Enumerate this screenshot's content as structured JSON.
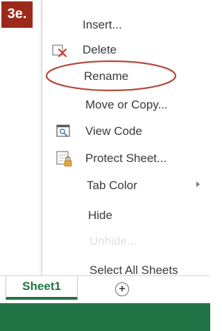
{
  "step_badge": "3e.",
  "menu": {
    "items": [
      {
        "label": "Insert...",
        "icon": null,
        "disabled": false,
        "submenu": false
      },
      {
        "label": "Delete",
        "icon": "delete-sheet-icon",
        "disabled": false,
        "submenu": false
      },
      {
        "label": "Rename",
        "icon": null,
        "disabled": false,
        "submenu": false,
        "highlighted": true
      },
      {
        "label": "Move or Copy...",
        "icon": null,
        "disabled": false,
        "submenu": false
      },
      {
        "label": "View Code",
        "icon": "view-code-icon",
        "disabled": false,
        "submenu": false
      },
      {
        "label": "Protect Sheet...",
        "icon": "protect-sheet-icon",
        "disabled": false,
        "submenu": false
      },
      {
        "label": "Tab Color",
        "icon": null,
        "disabled": false,
        "submenu": true
      },
      {
        "label": "Hide",
        "icon": null,
        "disabled": false,
        "submenu": false
      },
      {
        "label": "Unhide...",
        "icon": null,
        "disabled": true,
        "submenu": false
      },
      {
        "label": "Select All Sheets",
        "icon": null,
        "disabled": false,
        "submenu": false
      }
    ]
  },
  "tabs": {
    "active_sheet": "Sheet1",
    "new_sheet_symbol": "+"
  },
  "colors": {
    "badge": "#9c2a1a",
    "excel_green": "#217346",
    "highlight_ring": "#b24a3a",
    "delete_x": "#d83b2a",
    "lock": "#e6a23c"
  }
}
